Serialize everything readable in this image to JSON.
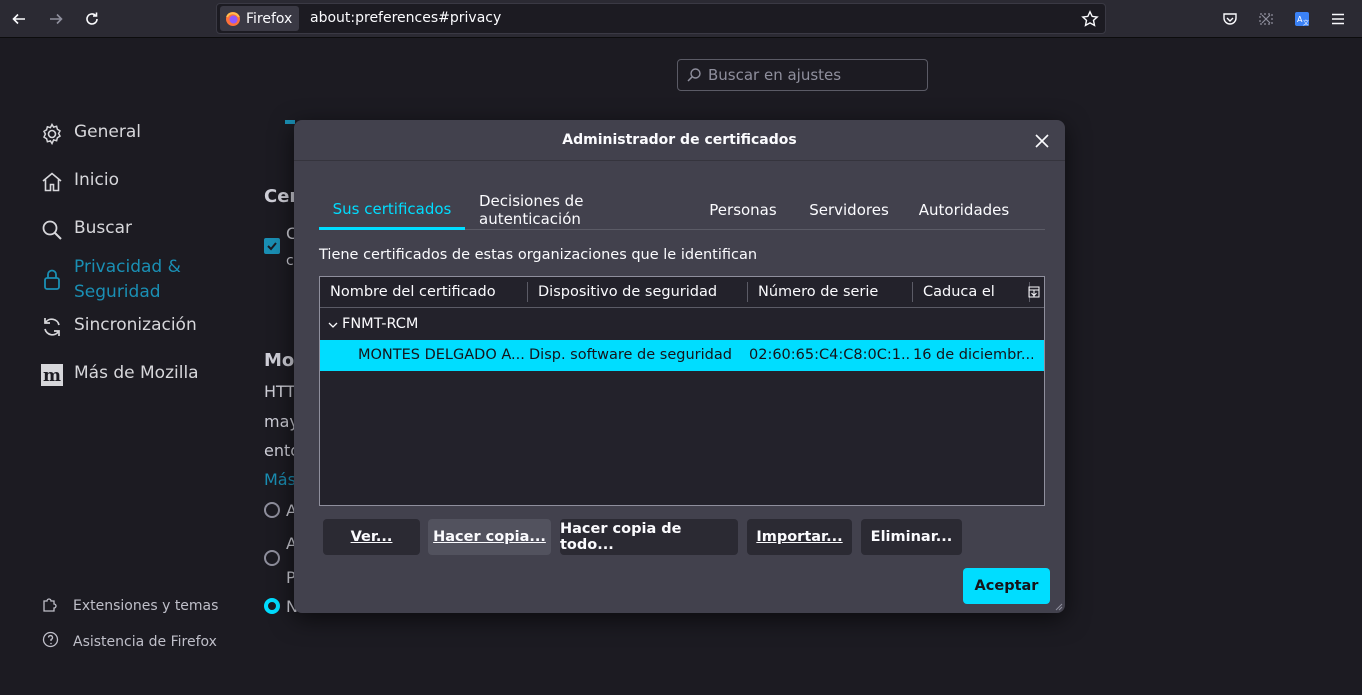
{
  "toolbar": {
    "identity_label": "Firefox",
    "url": "about:preferences#privacy",
    "icons": [
      "back-icon",
      "forward-icon",
      "reload-icon",
      "bookmark-star-icon",
      "pocket-icon",
      "screenshot-icon",
      "translate-icon",
      "menu-icon"
    ]
  },
  "search": {
    "placeholder": "Buscar en ajustes"
  },
  "sidebar": {
    "items": [
      {
        "label": "General",
        "icon": "gear-icon"
      },
      {
        "label": "Inicio",
        "icon": "home-icon"
      },
      {
        "label": "Buscar",
        "icon": "search-icon"
      },
      {
        "label": "Privacidad &\nSeguridad",
        "icon": "lock-icon",
        "active": true
      },
      {
        "label": "Sincronización",
        "icon": "sync-icon"
      },
      {
        "label": "Más de Mozilla",
        "icon": "mozilla-icon"
      }
    ],
    "footer": [
      {
        "label": "Extensiones y temas",
        "icon": "puzzle-icon"
      },
      {
        "label": "Asistencia de Firefox",
        "icon": "help-icon"
      }
    ]
  },
  "background": {
    "section1": "Cer",
    "checkbox_text_a": "C",
    "checkbox_text_b": "c",
    "section2": "Mod",
    "line1": "HTT",
    "line2": "may",
    "line3": "ento",
    "link": "Más",
    "radio1": "A",
    "radio2": "A",
    "radio2b": "P",
    "radio3": "N"
  },
  "dialog": {
    "title": "Administrador de certificados",
    "tabs": [
      "Sus certificados",
      "Decisiones de autenticación",
      "Personas",
      "Servidores",
      "Autoridades"
    ],
    "selected_tab": 0,
    "description": "Tiene certificados de estas organizaciones que le identifican",
    "columns": [
      "Nombre del certificado",
      "Dispositivo de seguridad",
      "Número de serie",
      "Caduca el"
    ],
    "group": "FNMT-RCM",
    "rows": [
      {
        "name": "MONTES DELGADO A...",
        "device": "Disp. software de seguridad",
        "serial": "02:60:65:C4:C8:0C:1...",
        "expires": "16 de diciembr..."
      }
    ],
    "buttons": {
      "view": "Ver...",
      "backup": "Hacer copia...",
      "backup_all": "Hacer copia de todo...",
      "import": "Importar...",
      "delete": "Eliminar..."
    },
    "accept": "Aceptar"
  },
  "colors": {
    "accent": "#00ddff",
    "link": "#1a8fb4",
    "dialog_bg": "#42414d",
    "page_bg": "#1c1b22"
  }
}
